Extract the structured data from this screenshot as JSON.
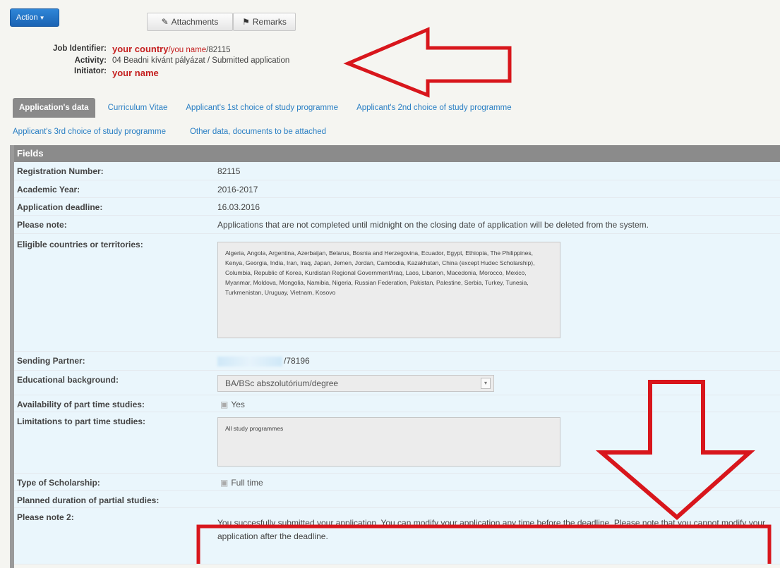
{
  "toolbar": {
    "action_label": "Action",
    "attachments_label": "Attachments",
    "remarks_label": "Remarks"
  },
  "job": {
    "job_identifier_label": "Job Identifier:",
    "job_identifier_country": "your country",
    "job_identifier_name": "/you name",
    "job_identifier_number": "/82115",
    "activity_label": "Activity:",
    "activity_value": "04 Beadni kívánt pályázat / Submitted application",
    "initiator_label": "Initiator:",
    "initiator_value": "your name"
  },
  "tabs": [
    {
      "label": "Application's data",
      "active": true
    },
    {
      "label": "Curriculum Vitae",
      "active": false
    },
    {
      "label": "Applicant's 1st choice of study programme",
      "active": false
    },
    {
      "label": "Applicant's 2nd choice of study programme",
      "active": false
    },
    {
      "label": "Applicant's 3rd choice of study programme",
      "active": false
    },
    {
      "label": "Other data, documents to be attached",
      "active": false
    }
  ],
  "fields": {
    "header": "Fields",
    "registration_number": {
      "label": "Registration Number:",
      "value": "82115"
    },
    "academic_year": {
      "label": "Academic Year:",
      "value": "2016-2017"
    },
    "application_deadline": {
      "label": "Application deadline:",
      "value": "16.03.2016"
    },
    "please_note": {
      "label": "Please note:",
      "value": "Applications that are not completed until midnight on the closing date of application will be deleted from the system."
    },
    "eligible_countries": {
      "label": "Eligible countries or territories:",
      "value": "Algeria, Angola, Argentina, Azerbaijan, Belarus, Bosnia and Herzegovina, Ecuador, Egypt, Ethiopia, The Philippines, Kenya, Georgia, India, Iran, Iraq, Japan, Jemen, Jordan, Cambodia, Kazakhstan, China (except Hudec Scholarship), Columbia, Republic of Korea, Kurdistan Regional Government/Iraq, Laos, Libanon, Macedonia, Morocco, Mexico, Myanmar, Moldova, Mongolia, Namibia, Nigeria, Russian Federation, Pakistan, Palestine, Serbia, Turkey, Tunesia, Turkmenistan, Uruguay, Vietnam, Kosovo"
    },
    "sending_partner": {
      "label": "Sending Partner:",
      "value": "/78196"
    },
    "educational_background": {
      "label": "Educational background:",
      "value": "BA/BSc abszolutórium/degree"
    },
    "part_time_availability": {
      "label": "Availability of part time studies:",
      "value": "Yes"
    },
    "part_time_limitations": {
      "label": "Limitations to part time studies:",
      "value": "All study programmes"
    },
    "scholarship_type": {
      "label": "Type of Scholarship:",
      "value": "Full time"
    },
    "planned_duration": {
      "label": "Planned duration of partial studies:"
    },
    "please_note_2": {
      "label": "Please note 2:",
      "value": "You succesfully submitted your application. You can modify your application any time before the deadline. Please note that you cannot modify your application after the deadline."
    }
  },
  "colors": {
    "annotation_red": "#d8161c",
    "tab_link": "#2a7fc4",
    "action_blue": "#1f6fc4"
  }
}
